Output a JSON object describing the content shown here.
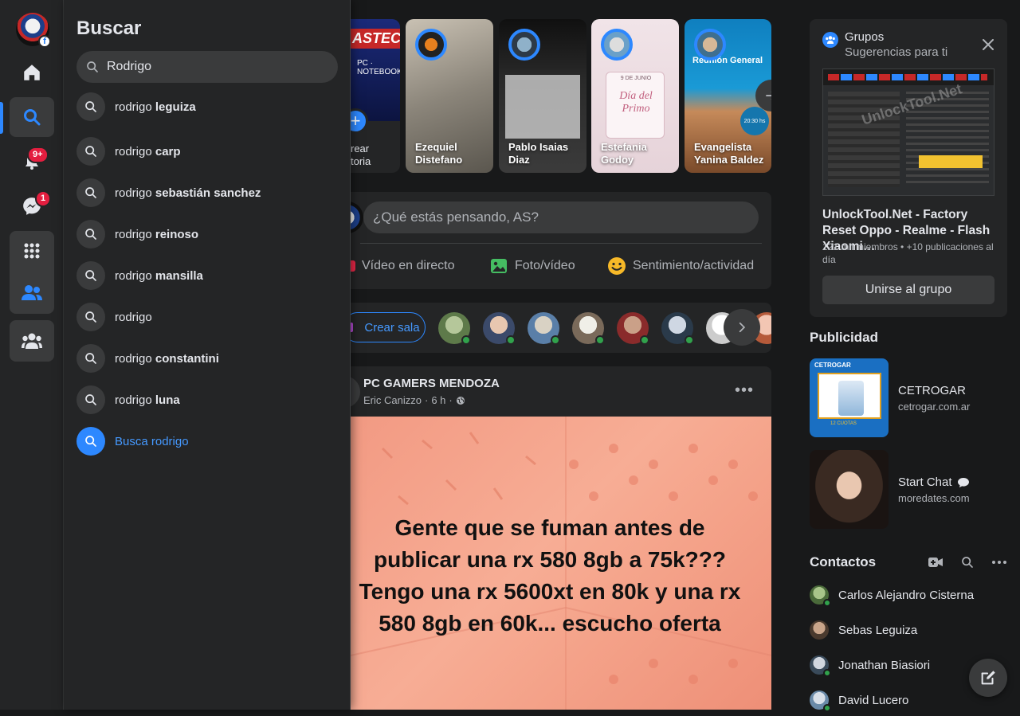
{
  "rail": {
    "notifications_badge": "9+",
    "messenger_badge": "1"
  },
  "search": {
    "title": "Buscar",
    "query": "Rodrigo",
    "suggestions": [
      {
        "prefix": "rodrigo ",
        "bold": "leguiza"
      },
      {
        "prefix": "rodrigo ",
        "bold": "carp"
      },
      {
        "prefix": "rodrigo ",
        "bold": "sebastián sanchez"
      },
      {
        "prefix": "rodrigo ",
        "bold": "reinoso"
      },
      {
        "prefix": "rodrigo ",
        "bold": "mansilla"
      },
      {
        "prefix": "rodrigo",
        "bold": ""
      },
      {
        "prefix": "rodrigo ",
        "bold": "constantini"
      },
      {
        "prefix": "rodrigo ",
        "bold": "luna"
      }
    ],
    "search_for": "Busca rodrigo"
  },
  "stories": [
    {
      "name_line1": "rear",
      "name_line2": "toria",
      "banner": "ASTECNIC",
      "sub": "PC · NOTEBOOK"
    },
    {
      "name_line1": "Ezequiel",
      "name_line2": "Distefano"
    },
    {
      "name_line1": "Pablo Isaias",
      "name_line2": "Diaz"
    },
    {
      "name_line1": "Estefania",
      "name_line2": "Godoy",
      "card_date": "9 DE JUNIO",
      "card_text": "Día del Primo"
    },
    {
      "name_line1": "Evangelista",
      "name_line2": "Yanina Baldez",
      "card_heading": "Reunión General",
      "card_time": "20:30 hs"
    }
  ],
  "composer": {
    "placeholder": "¿Qué estás pensando, AS?",
    "live": "Vídeo en directo",
    "photo": "Foto/vídeo",
    "feeling": "Sentimiento/actividad"
  },
  "rooms": {
    "create": "Crear sala"
  },
  "post": {
    "group": "PC GAMERS MENDOZA",
    "author": "Eric Canizzo",
    "time": "6 h",
    "sep": "·",
    "more": "•••",
    "text": "Gente que se fuman antes de\npublicar una rx 580 8gb a 75k???\nTengo una rx 5600xt en 80k y una rx\n580 8gb en 60k... escucho oferta"
  },
  "groups_card": {
    "title": "Grupos",
    "subtitle": "Sugerencias para ti",
    "name": "UnlockTool.Net - Factory Reset Oppo - Realme - Flash Xiaomi…",
    "meta": "121 mil miembros • +10 publicaciones al día",
    "join": "Unirse al grupo",
    "thumb_watermark": "UnlockTool.Net"
  },
  "ads": {
    "heading": "Publicidad",
    "items": [
      {
        "title": "CETROGAR",
        "url": "cetrogar.com.ar",
        "img_brand": "CETROGAR",
        "img_caption": "12 CUOTAS"
      },
      {
        "title": "Start Chat",
        "url": "moredates.com"
      }
    ]
  },
  "contacts": {
    "heading": "Contactos",
    "items": [
      "Carlos Alejandro Cisterna",
      "Sebas Leguiza",
      "Jonathan Biasiori",
      "David Lucero"
    ]
  },
  "colors": {
    "accent": "#2d88ff",
    "badge": "#e41e3f",
    "online": "#31a24c",
    "post_bg": "#f5a58c"
  }
}
